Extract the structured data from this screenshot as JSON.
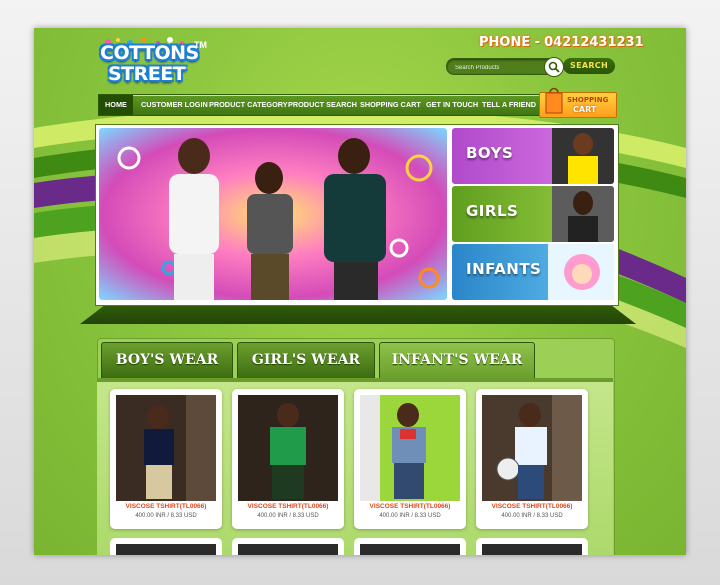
{
  "brand": {
    "line1": "COTTONS",
    "line2": "STREET",
    "tm": "TM"
  },
  "header": {
    "phone_label": "PHONE -",
    "phone_number": "04212431231"
  },
  "search": {
    "placeholder": "Search Products",
    "button": "SEARCH"
  },
  "nav": {
    "items": [
      "HOME",
      "CUSTOMER LOGIN",
      "PRODUCT CATEGORY",
      "PRODUCT SEARCH",
      "SHOPPING CART",
      "GET IN TOUCH",
      "TELL A FRIEND"
    ],
    "active": "HOME"
  },
  "cart": {
    "line1": "SHOPPING",
    "line2": "CART"
  },
  "categories": [
    {
      "label": "BOYS",
      "color": "#c24fd0"
    },
    {
      "label": "GIRLS",
      "color": "#7ab82e"
    },
    {
      "label": "INFANTS",
      "color": "#3aa3e0"
    }
  ],
  "tabs": [
    "BOY'S WEAR",
    "GIRL'S WEAR",
    "INFANT'S WEAR"
  ],
  "active_tab": "INFANT'S WEAR",
  "products": [
    {
      "name": "VISCOSE TSHIRT(TL0066)",
      "price": "400.00 INR / 8.33 USD"
    },
    {
      "name": "VISCOSE TSHIRT(TL0066)",
      "price": "400.00 INR / 8.33 USD"
    },
    {
      "name": "VISCOSE TSHIRT(TL0066)",
      "price": "400.00 INR / 8.33 USD"
    },
    {
      "name": "VISCOSE TSHIRT(TL0066)",
      "price": "400.00 INR / 8.33 USD"
    }
  ],
  "colors": {
    "accent": "#8cc63f",
    "nav": "#3f7511",
    "price_name": "#e0471a",
    "phone": "#ff8a1d"
  }
}
